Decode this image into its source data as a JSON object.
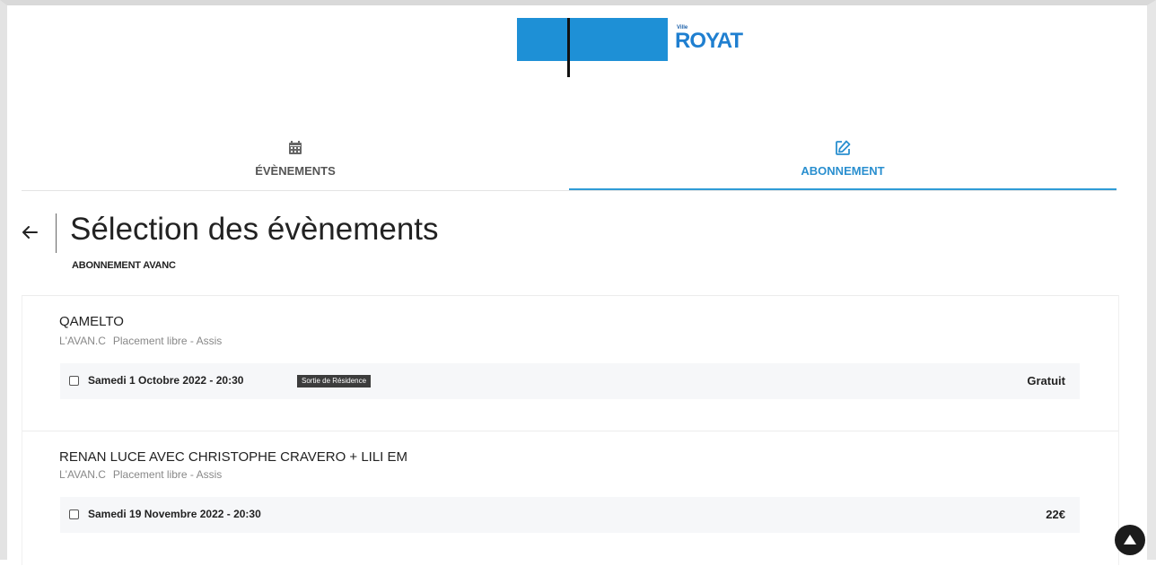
{
  "header": {
    "logo_small": "Ville",
    "logo_brand": "ROYAT",
    "colors": {
      "logo_blue": "#1e90d6",
      "accent": "#2f9bd6"
    }
  },
  "tabs": [
    {
      "label": "ÉVÈNEMENTS",
      "icon": "calendar-icon",
      "active": false
    },
    {
      "label": "ABONNEMENT",
      "icon": "edit-icon",
      "active": true
    }
  ],
  "page": {
    "title": "Sélection des évènements",
    "subtitle": "ABONNEMENT AVANC"
  },
  "events": [
    {
      "name": "QAMELTO",
      "venue": "L'AVAN.C",
      "placement": "Placement libre - Assis",
      "session": {
        "date": "Samedi 1 Octobre 2022 - 20:30",
        "badge": "Sortie de Résidence",
        "price": "Gratuit"
      }
    },
    {
      "name": "RENAN LUCE AVEC CHRISTOPHE CRAVERO + LILI EM",
      "venue": "L'AVAN.C",
      "placement": "Placement libre - Assis",
      "session": {
        "date": "Samedi 19 Novembre 2022 - 20:30",
        "badge": "",
        "price": "22€"
      }
    }
  ]
}
